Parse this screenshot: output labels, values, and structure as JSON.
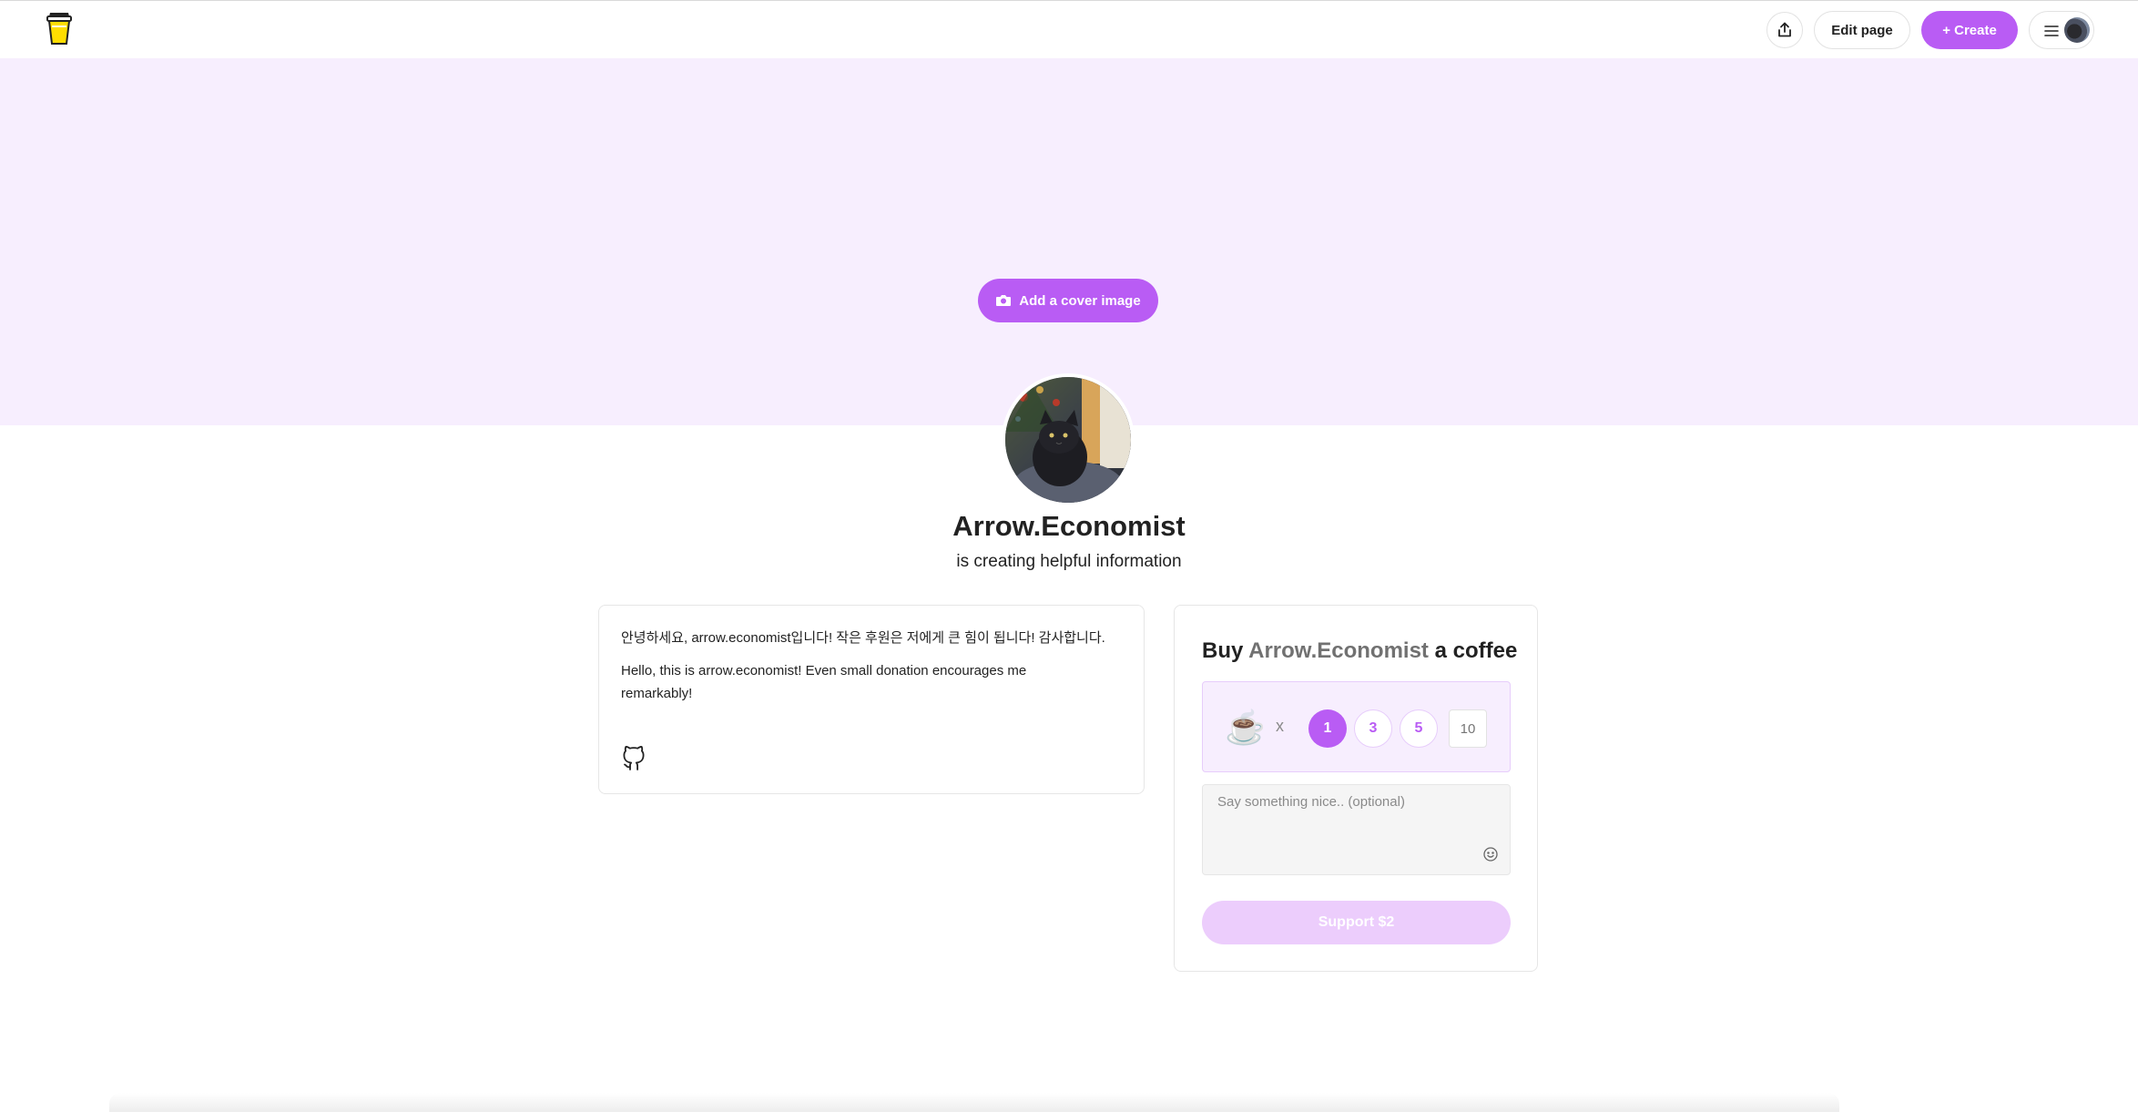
{
  "header": {
    "logo_icon": "coffee-cup-logo-icon",
    "share_icon": "share-icon",
    "edit_label": "Edit page",
    "create_label": "+ Create",
    "menu_icon": "hamburger-icon"
  },
  "cover": {
    "button_label": "Add a cover image",
    "button_icon": "camera-icon",
    "background": "#f7eefe"
  },
  "profile": {
    "name": "Arrow.Economist",
    "tagline": "is creating helpful information"
  },
  "about": {
    "text_kr": "안녕하세요, arrow.economist입니다! 작은 후원은 저에게 큰 힘이 됩니다! 감사합니다.",
    "text_en": "Hello, this is arrow.economist! Even small donation encourages me remarkably!",
    "social_icon": "github-icon"
  },
  "support": {
    "title_prefix": "Buy",
    "title_name": "Arrow.Economist",
    "title_suffix": "a coffee",
    "cup_emoji": "☕",
    "times_symbol": "x",
    "quantities": [
      "1",
      "3",
      "5"
    ],
    "selected_quantity": "1",
    "custom_quantity_placeholder": "10",
    "message_placeholder": "Say something nice.. (optional)",
    "emoji_icon": "smiley-icon",
    "button_label": "Support $2"
  },
  "colors": {
    "accent": "#b95cf4",
    "accent_light": "#f7eefe",
    "button_disabled": "#eccdfc"
  }
}
